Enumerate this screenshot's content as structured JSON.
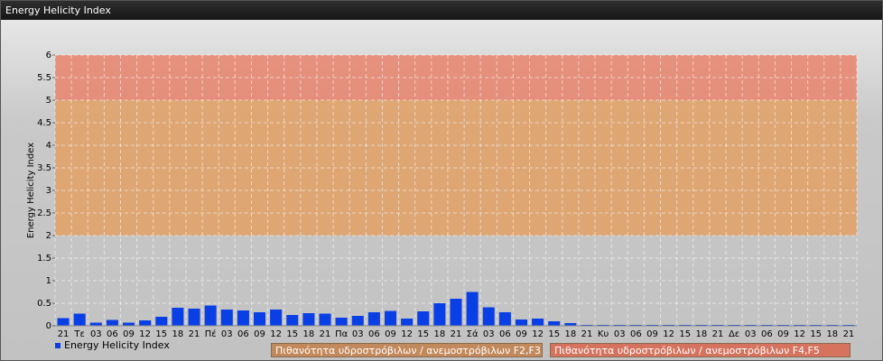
{
  "window": {
    "title": "Energy Helicity Index"
  },
  "colors": {
    "bar": "#0a3fe6",
    "band_low": "#c4c4c4",
    "band_mid": "#e0a064",
    "band_high": "#e8846c",
    "legend_band1": "#c2895c",
    "legend_band2": "#d5735e"
  },
  "chart_data": {
    "type": "bar",
    "ylabel": "Energy Helicity Index",
    "ylim": [
      0,
      6
    ],
    "yticks": [
      "0",
      "0.5",
      "1",
      "1.5",
      "2",
      "2.5",
      "3",
      "3.5",
      "4",
      "4.5",
      "5",
      "5.5",
      "6"
    ],
    "grid": true,
    "bands": [
      {
        "from": 2,
        "to": 5,
        "label": "Πιθανότητα υδροστρόβιλων / ανεμοστρόβιλων F2,F3"
      },
      {
        "from": 5,
        "to": 6,
        "label": "Πιθανότητα υδροστρόβιλων / ανεμοστρόβιλων F4,F5"
      }
    ],
    "categories": [
      "21",
      "Τε",
      "03",
      "06",
      "09",
      "12",
      "15",
      "18",
      "21",
      "Πέ",
      "03",
      "06",
      "09",
      "12",
      "15",
      "18",
      "21",
      "Πα",
      "03",
      "06",
      "09",
      "12",
      "15",
      "18",
      "21",
      "Σά",
      "03",
      "06",
      "09",
      "12",
      "15",
      "18",
      "21",
      "Κυ",
      "03",
      "06",
      "09",
      "12",
      "15",
      "18",
      "21",
      "Δε",
      "03",
      "06",
      "09",
      "12",
      "15",
      "18",
      "21"
    ],
    "series": [
      {
        "name": "Energy Helicity Index",
        "values": [
          0.17,
          0.27,
          0.07,
          0.13,
          0.07,
          0.12,
          0.2,
          0.4,
          0.38,
          0.45,
          0.36,
          0.34,
          0.3,
          0.36,
          0.24,
          0.28,
          0.27,
          0.18,
          0.22,
          0.3,
          0.33,
          0.16,
          0.32,
          0.5,
          0.6,
          0.75,
          0.41,
          0.3,
          0.14,
          0.16,
          0.1,
          0.06,
          0.02,
          0.02,
          0.02,
          0.02,
          0.02,
          0.02,
          0.02,
          0.02,
          0.02,
          0.02,
          0.02,
          0.02,
          0.02,
          0.02,
          0.02,
          0.02,
          0.02
        ]
      }
    ],
    "legend_position": "bottom-left"
  }
}
